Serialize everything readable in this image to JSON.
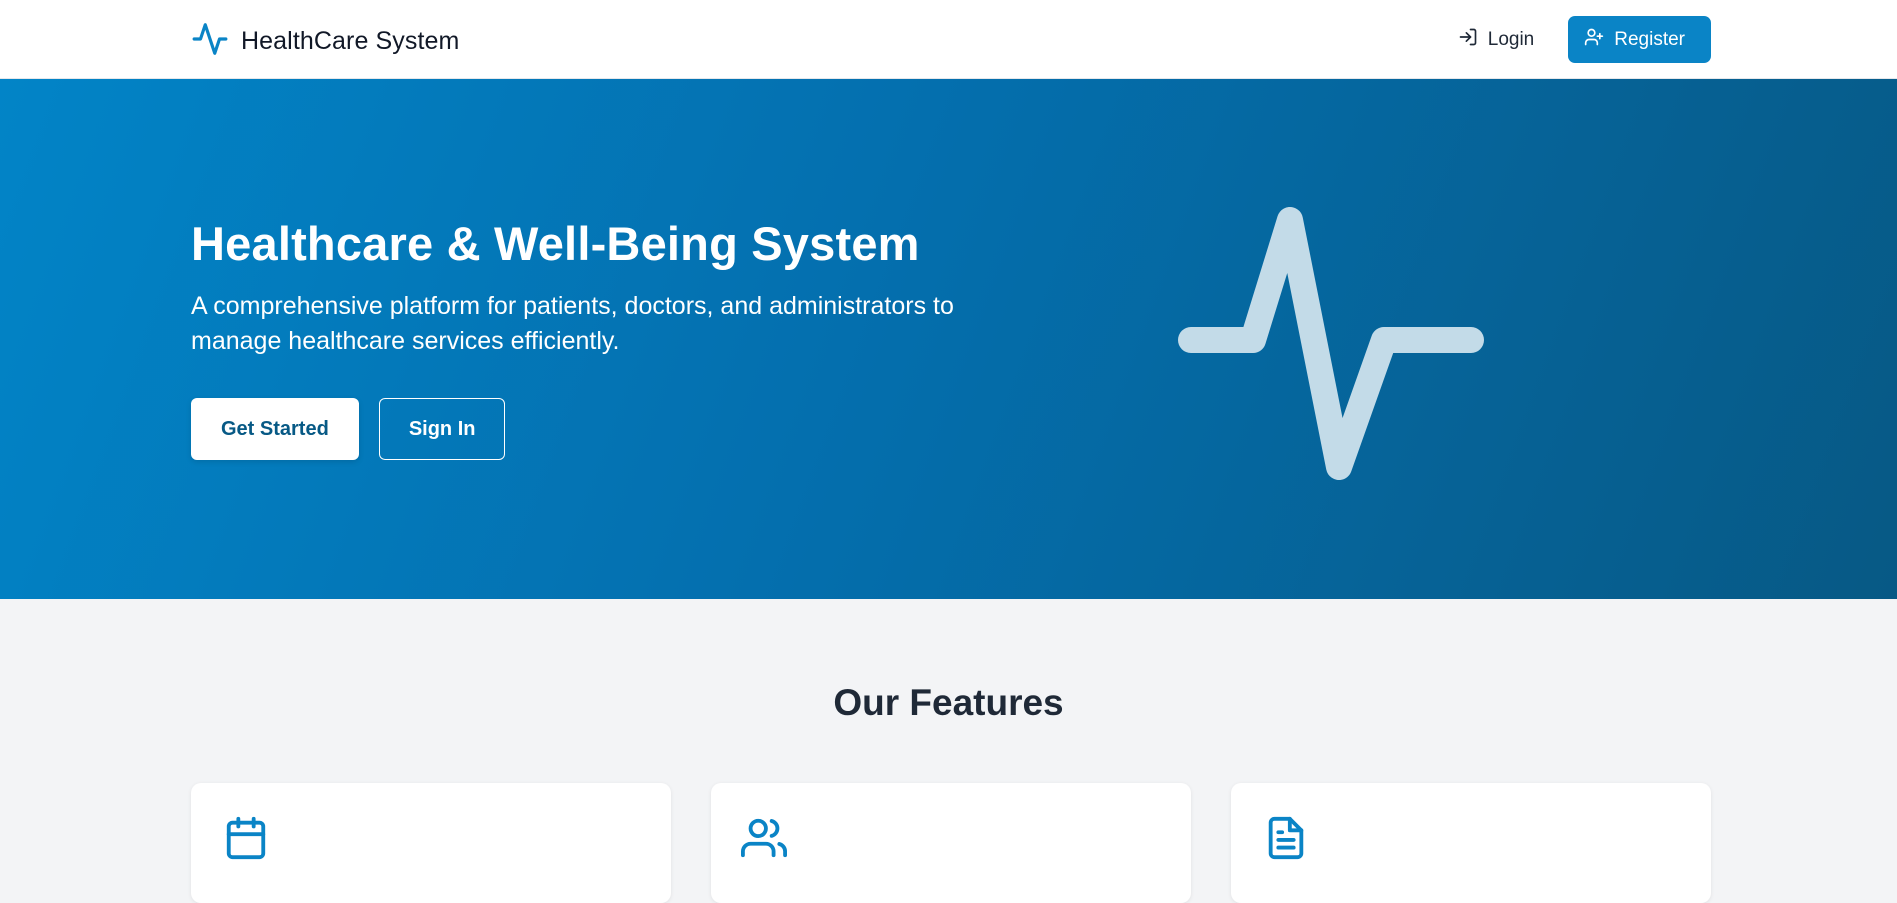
{
  "navbar": {
    "brand_name": "HealthCare System",
    "brand_icon": "activity-pulse-icon",
    "login_label": "Login",
    "login_icon": "log-in-icon",
    "register_label": "Register",
    "register_icon": "user-plus-icon"
  },
  "hero": {
    "title": "Healthcare & Well-Being System",
    "subtitle": "A comprehensive platform for patients, doctors, and administrators to manage healthcare services efficiently.",
    "get_started_label": "Get Started",
    "sign_in_label": "Sign In",
    "illustration_icon": "activity-pulse-icon"
  },
  "features": {
    "title": "Our Features",
    "cards": [
      {
        "icon": "calendar-icon"
      },
      {
        "icon": "users-icon"
      },
      {
        "icon": "file-text-icon"
      }
    ]
  },
  "colors": {
    "brand_blue": "#0a84c6",
    "hero_gradient_start": "#0284c7",
    "hero_gradient_end": "#075985",
    "page_background": "#f3f4f6",
    "pulse_illustration": "#c3dbe8"
  }
}
